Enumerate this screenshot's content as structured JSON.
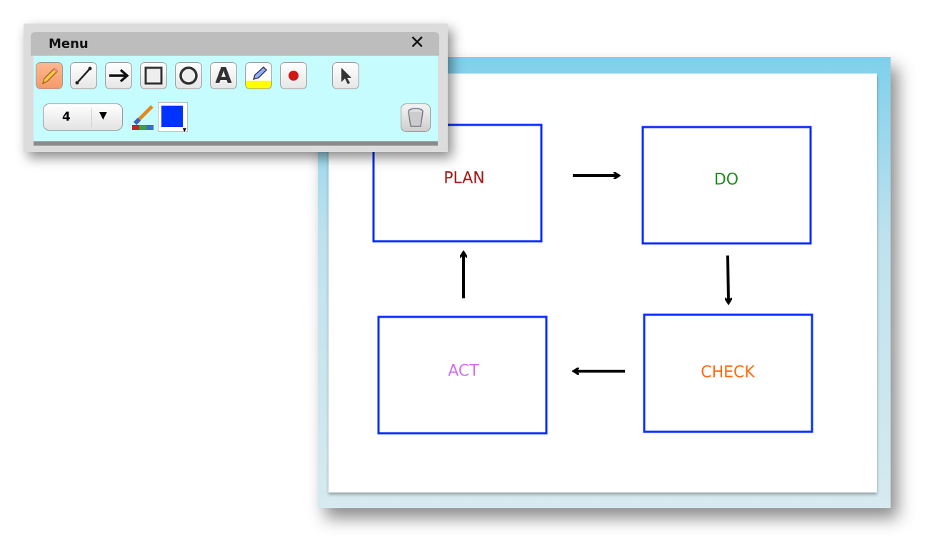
{
  "toolbar": {
    "title": "Menu",
    "close_icon": "close-icon",
    "tools": [
      {
        "name": "pencil",
        "icon": "pencil-icon",
        "active": true
      },
      {
        "name": "line",
        "icon": "line-icon"
      },
      {
        "name": "arrow",
        "icon": "arrow-icon"
      },
      {
        "name": "rectangle",
        "icon": "rectangle-icon"
      },
      {
        "name": "ellipse",
        "icon": "ellipse-icon"
      },
      {
        "name": "text",
        "icon": "text-icon",
        "glyph": "A"
      },
      {
        "name": "highlighter",
        "icon": "highlighter-icon"
      },
      {
        "name": "record",
        "icon": "record-icon"
      },
      {
        "name": "select",
        "icon": "cursor-icon"
      }
    ],
    "line_width": "4",
    "color": "#0033ff",
    "trash_icon": "trash-icon"
  },
  "diagram": {
    "boxes": [
      {
        "label": "PLAN",
        "color": "#a01818"
      },
      {
        "label": "DO",
        "color": "#1e8a1e"
      },
      {
        "label": "CHECK",
        "color": "#ff6a10"
      },
      {
        "label": "ACT",
        "color": "#d070f0"
      }
    ],
    "border_color": "#0a2cff"
  }
}
